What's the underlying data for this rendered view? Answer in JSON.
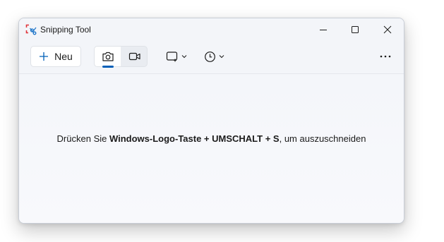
{
  "window": {
    "title": "Snipping Tool"
  },
  "toolbar": {
    "new_label": "Neu",
    "modes": [
      {
        "name": "screenshot",
        "icon": "camera-icon",
        "selected": true
      },
      {
        "name": "video",
        "icon": "video-camera-icon",
        "selected": false
      }
    ],
    "snip_shape_icon": "rectangle-snip-icon",
    "delay_icon": "clock-icon",
    "more_icon": "more-icon"
  },
  "content": {
    "hint_pre": "Drücken Sie ",
    "hint_keys": "Windows-Logo-Taste + UMSCHALT + S",
    "hint_post": ", um auszuschneiden"
  },
  "colors": {
    "accent": "#005fb8",
    "window_bg": "#f3f5f9"
  }
}
